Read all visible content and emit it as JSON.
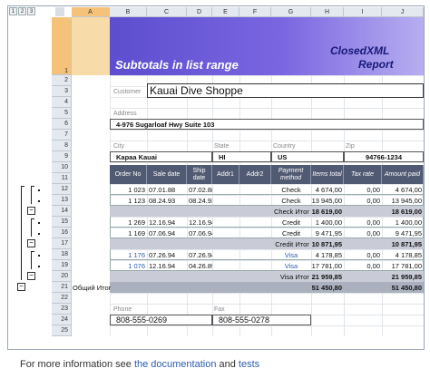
{
  "levels": [
    "1",
    "2",
    "3"
  ],
  "columns": [
    "A",
    "B",
    "C",
    "D",
    "E",
    "F",
    "G",
    "H",
    "I",
    "J"
  ],
  "rows": [
    "1",
    "2",
    "3",
    "4",
    "5",
    "6",
    "7",
    "8",
    "9",
    "10",
    "11",
    "12",
    "13",
    "14",
    "15",
    "16",
    "17",
    "18",
    "19",
    "20",
    "21",
    "22",
    "23",
    "24",
    "25"
  ],
  "title": "Subtotals in list range",
  "logo_line1": "ClosedXML",
  "logo_line2": "Report",
  "customer_label": "Customer",
  "customer_name": "Kauai Dive Shoppe",
  "address_label": "Address",
  "address": "4-976 Sugarloaf Hwy Suite 103",
  "city_label": "City",
  "state_label": "State",
  "country_label": "Country",
  "zip_label": "Zip",
  "city": "Kapaa Kauai",
  "state": "HI",
  "country": "US",
  "zip": "94766-1234",
  "table_headers": [
    "Order No",
    "Sale date",
    "Ship date",
    "Addr1",
    "Addr2",
    "Payment method",
    "Items total",
    "Tax rate",
    "Amount paid"
  ],
  "table_rows": [
    {
      "order": "1 023",
      "sale": "07.01.88",
      "ship": "07.02.88",
      "pay": "Check",
      "items": "4 674,00",
      "tax": "0,00",
      "amount": "4 674,00",
      "link": false
    },
    {
      "order": "1 123",
      "sale": "08.24.93",
      "ship": "08.24.93",
      "pay": "Check",
      "items": "13 945,00",
      "tax": "0,00",
      "amount": "13 945,00",
      "link": false
    },
    {
      "order": "1 269",
      "sale": "12.16.94",
      "ship": "12.16.94",
      "pay": "Credit",
      "items": "1 400,00",
      "tax": "0,00",
      "amount": "1 400,00",
      "link": false
    },
    {
      "order": "1 169",
      "sale": "07.06.94",
      "ship": "07.06.94",
      "pay": "Credit",
      "items": "9 471,95",
      "tax": "0,00",
      "amount": "9 471,95",
      "link": false
    },
    {
      "order": "1 176",
      "sale": "07.26.94",
      "ship": "07.26.94",
      "pay": "Visa",
      "items": "4 178,85",
      "tax": "0,00",
      "amount": "4 178,85",
      "link": true
    },
    {
      "order": "1 076",
      "sale": "12.16.94",
      "ship": "04.26.89",
      "pay": "Visa",
      "items": "17 781,00",
      "tax": "0,00",
      "amount": "17 781,00",
      "link": true
    }
  ],
  "subtotals": [
    {
      "label": "Check Итог",
      "items": "18 619,00",
      "amount": "18 619,00"
    },
    {
      "label": "Credit Итог",
      "items": "10 871,95",
      "amount": "10 871,95"
    },
    {
      "label": "Visa Итог",
      "items": "21 959,85",
      "amount": "21 959,85"
    }
  ],
  "grand_total_label": "Общий Итог",
  "grand_total_items": "51 450,80",
  "grand_total_amount": "51 450,80",
  "phone_label": "Phone",
  "fax_label": "Fax",
  "phone": "808-555-0269",
  "fax": "808-555-0278",
  "footer_prefix": "For more information see ",
  "footer_link1": "the documentation",
  "footer_mid": " and ",
  "footer_link2": "tests",
  "colors": {
    "title_band": "#6a58d8",
    "header_dark": "#505a72",
    "subtotal": "#c9ccd6",
    "grandtotal": "#aab0be",
    "selected": "#f5c27a",
    "link": "#2a5db0"
  }
}
